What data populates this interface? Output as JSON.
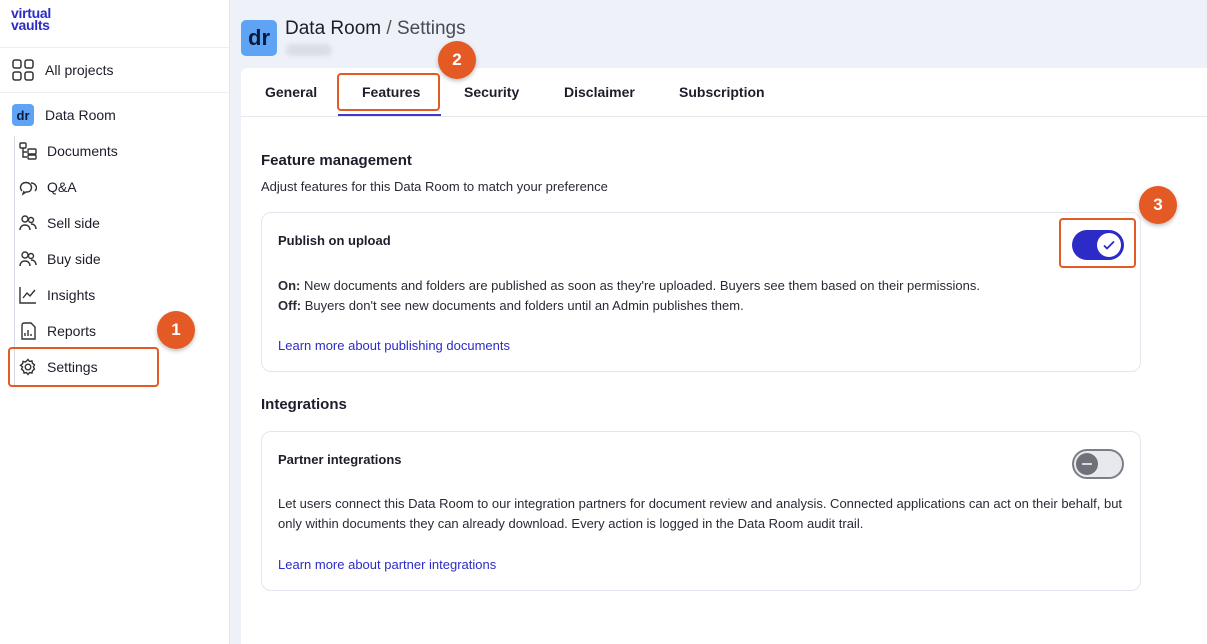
{
  "logo": {
    "line1": "virtual",
    "line2": "vaults",
    "icon": "virtual-vaults-logo"
  },
  "sidebar": {
    "all_projects": {
      "label": "All projects",
      "icon": "grid-icon"
    },
    "project": {
      "badge": "dr",
      "label": "Data Room"
    },
    "items": [
      {
        "label": "Documents",
        "icon": "folder-tree-icon"
      },
      {
        "label": "Q&A",
        "icon": "chat-bubbles-icon"
      },
      {
        "label": "Sell side",
        "icon": "users-icon"
      },
      {
        "label": "Buy side",
        "icon": "users-icon"
      },
      {
        "label": "Insights",
        "icon": "line-chart-icon"
      },
      {
        "label": "Reports",
        "icon": "report-icon"
      },
      {
        "label": "Settings",
        "icon": "gear-icon"
      }
    ]
  },
  "header": {
    "badge": "dr",
    "project": "Data Room",
    "separator": "/",
    "page": "Settings"
  },
  "tabs": [
    {
      "label": "General"
    },
    {
      "label": "Features",
      "active": true
    },
    {
      "label": "Security"
    },
    {
      "label": "Disclaimer"
    },
    {
      "label": "Subscription"
    }
  ],
  "feature_management": {
    "title": "Feature management",
    "description": "Adjust features for this Data Room to match your preference",
    "publish_on_upload": {
      "title": "Publish on upload",
      "enabled": true,
      "on_label": "On:",
      "on_text": " New documents and folders are published as soon as they're uploaded. Buyers see them based on their permissions.",
      "off_label": "Off:",
      "off_text": " Buyers don't see new documents and folders until an Admin publishes them.",
      "link": "Learn more about publishing documents"
    }
  },
  "integrations": {
    "title": "Integrations",
    "partner": {
      "title": "Partner integrations",
      "enabled": false,
      "text": "Let users connect this Data Room to our integration partners for document review and analysis. Connected applications can act on their behalf, but only within documents they can already download. Every action is logged in the Data Room audit trail.",
      "link": "Learn more about partner integrations"
    }
  },
  "annotations": {
    "step1": "1",
    "step2": "2",
    "step3": "3"
  },
  "colors": {
    "accent": "#2d2bc7",
    "badge_blue": "#5fa3f5",
    "annotation": "#e45a25"
  }
}
